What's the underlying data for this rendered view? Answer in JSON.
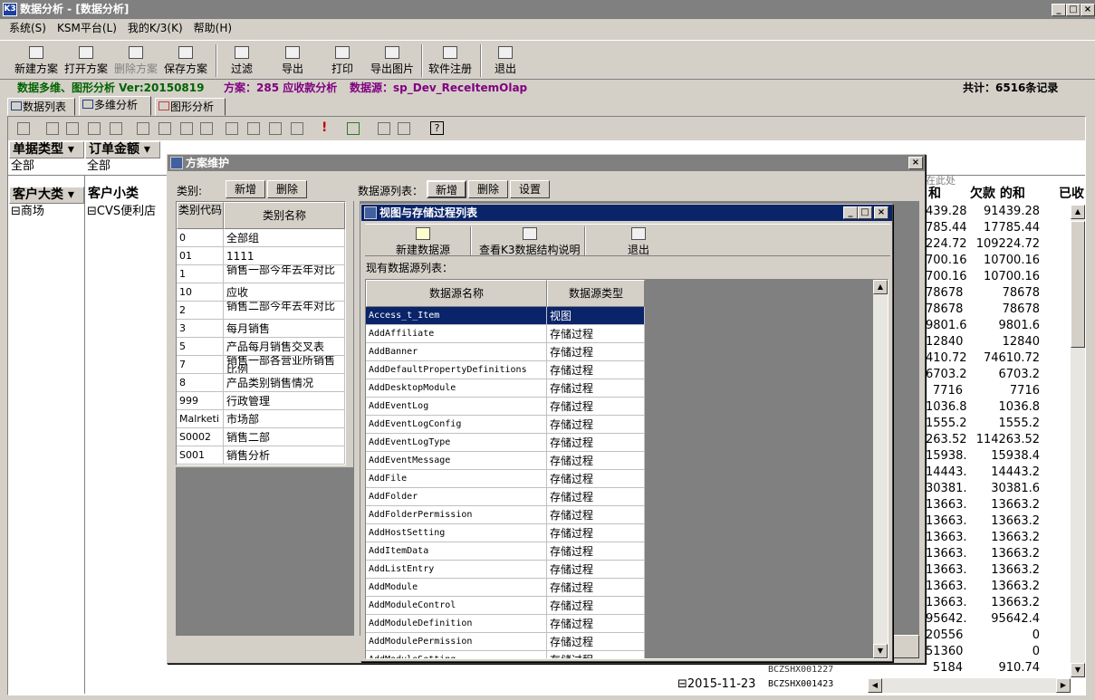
{
  "window": {
    "title": "数据分析 - [数据分析]",
    "icon": "app-k3-icon"
  },
  "menu": [
    "系统(S)",
    "KSM平台(L)",
    "我的K/3(K)",
    "帮助(H)"
  ],
  "toolbar": {
    "new_scheme": "新建方案",
    "open_scheme": "打开方案",
    "delete_scheme": "删除方案",
    "save_scheme": "保存方案",
    "filter": "过滤",
    "export": "导出",
    "print": "打印",
    "export_image": "导出图片",
    "register": "软件注册",
    "exit": "退出"
  },
  "info": {
    "version": "数据多维、图形分析 Ver:20150819",
    "scheme": "方案：285 应收款分析",
    "datasource": "数据源：sp_Dev_ReceItemOlap",
    "total": "共计：6516条记录"
  },
  "tabs": [
    "数据列表",
    "多维分析",
    "图形分析"
  ],
  "pivot": {
    "filter_fields": [
      {
        "name": "单据类型",
        "value": "全部"
      },
      {
        "name": "订单金额",
        "value": "全部"
      }
    ],
    "row_fields": [
      "客户大类",
      "客户小类"
    ],
    "row_values": {
      "major": "⊟商场",
      "minor": "⊟CVS便利店"
    },
    "drop_hint": "在此处",
    "col_headers": [
      "和",
      "欠款 的和",
      "已收"
    ],
    "col_a": [
      "439.28",
      "785.44",
      "224.72",
      "700.16",
      "700.16",
      "78678",
      "78678",
      "9801.6",
      "12840",
      "410.72",
      "6703.2",
      "7716",
      "1036.8",
      "1555.2",
      "263.52",
      "15938.4",
      "14443.2",
      "30381.6",
      "13663.2",
      "13663.2",
      "13663.2",
      "13663.2",
      "13663.2",
      "13663.2",
      "13663.2",
      "95642.4",
      "20556",
      "51360",
      "5184"
    ],
    "col_b": [
      "91439.28",
      "17785.44",
      "109224.72",
      "10700.16",
      "10700.16",
      "78678",
      "78678",
      "9801.6",
      "12840",
      "74610.72",
      "6703.2",
      "7716",
      "1036.8",
      "1555.2",
      "114263.52",
      "15938.4",
      "14443.2",
      "30381.6",
      "13663.2",
      "13663.2",
      "13663.2",
      "13663.2",
      "13663.2",
      "13663.2",
      "13663.2",
      "95642.4",
      "0",
      "0",
      "910.74"
    ],
    "bottom_row": {
      "date": "⊟2015-11-23",
      "code_a": "BCZSHX001227",
      "code_b": "BCZSHX001423"
    }
  },
  "scheme_dialog": {
    "title": "方案维护",
    "category_label": "类别:",
    "add": "新增",
    "delete": "删除",
    "ds_list_label": "数据源列表：",
    "ds_add": "新增",
    "ds_delete": "删除",
    "ds_settings": "设置",
    "col_code": "类别代码",
    "col_name": "类别名称",
    "rows": [
      [
        "0",
        "全部组"
      ],
      [
        "01",
        "1111"
      ],
      [
        "1",
        "销售一部今年去年对比"
      ],
      [
        "10",
        "应收"
      ],
      [
        "2",
        "销售二部今年去年对比"
      ],
      [
        "3",
        "每月销售"
      ],
      [
        "5",
        "产品每月销售交叉表"
      ],
      [
        "7",
        "销售一部各营业所销售比例"
      ],
      [
        "8",
        "产品类别销售情况"
      ],
      [
        "999",
        "行政管理"
      ],
      [
        "Malrketi",
        "市场部"
      ],
      [
        "S0002",
        "销售二部"
      ],
      [
        "S001",
        "销售分析"
      ]
    ]
  },
  "view_dialog": {
    "title": "视图与存储过程列表",
    "new_ds": "新建数据源",
    "view_k3": "查看K3数据结构说明",
    "exit": "退出",
    "existing_label": "现有数据源列表：",
    "col_name": "数据源名称",
    "col_type": "数据源类型",
    "rows": [
      [
        "Access_t_Item",
        "视图"
      ],
      [
        "AddAffiliate",
        "存储过程"
      ],
      [
        "AddBanner",
        "存储过程"
      ],
      [
        "AddDefaultPropertyDefinitions",
        "存储过程"
      ],
      [
        "AddDesktopModule",
        "存储过程"
      ],
      [
        "AddEventLog",
        "存储过程"
      ],
      [
        "AddEventLogConfig",
        "存储过程"
      ],
      [
        "AddEventLogType",
        "存储过程"
      ],
      [
        "AddEventMessage",
        "存储过程"
      ],
      [
        "AddFile",
        "存储过程"
      ],
      [
        "AddFolder",
        "存储过程"
      ],
      [
        "AddFolderPermission",
        "存储过程"
      ],
      [
        "AddHostSetting",
        "存储过程"
      ],
      [
        "AddItemData",
        "存储过程"
      ],
      [
        "AddListEntry",
        "存储过程"
      ],
      [
        "AddModule",
        "存储过程"
      ],
      [
        "AddModuleControl",
        "存储过程"
      ],
      [
        "AddModuleDefinition",
        "存储过程"
      ],
      [
        "AddModulePermission",
        "存储过程"
      ],
      [
        "AddModuleSetting",
        "存储过程"
      ]
    ]
  }
}
